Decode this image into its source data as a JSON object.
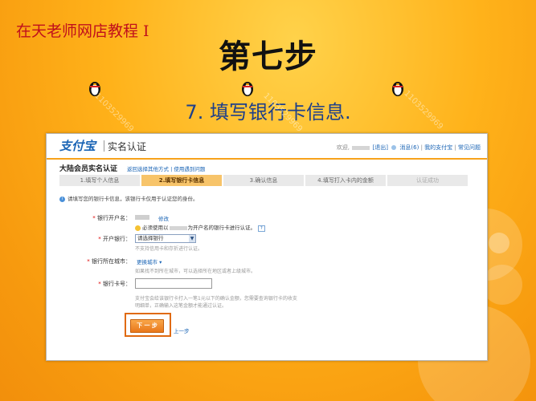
{
  "slide": {
    "header": "在天老师网店教程 I",
    "title": "第七步",
    "subtitle": "7. 填写银行卡信息."
  },
  "watermark": "1103529969",
  "screen": {
    "logo": "支付宝",
    "page_title": "实名认证",
    "topbar_right": {
      "welcome": "欢迎,",
      "logout": "[退出]",
      "messages": "消息(6)",
      "my_alipay": "我的支付宝",
      "help": "常见问题"
    },
    "section_title": "大陆会员实名认证",
    "section_links": "返回选择其他方式 | 使用遇到问题",
    "steps": [
      "1.填写个人信息",
      "2.填写银行卡信息",
      "3.确认信息",
      "4.填写打入卡内的金额",
      "认证成功"
    ],
    "notice": "请填写您的银行卡信息，该银行卡仅用于认证您的身份。",
    "form": {
      "account_name_label": "银行开户名：",
      "modify_link": "修改",
      "account_name_hint_before": "必须使用以",
      "account_name_hint_after": "为开户名的银行卡进行认证。",
      "help_mark": "?",
      "bank_label": "开户银行：",
      "bank_select": "请选择银行",
      "bank_hint": "不支持信用卡和存折进行认证。",
      "city_label": "银行所在城市：",
      "city_select": "更换城市 ▾",
      "city_hint": "如果找不到所在城市，可以选择所在地区或者上级城市。",
      "card_label": "银行卡号：",
      "card_value": "",
      "card_hint": "支付宝会给该银行卡打入一笔1元以下的确认金额，您需要查询银行卡的收支明细单，正确输入这笔金额才能通过认证。",
      "next_button": "下 一 步",
      "prev_link": "上一步"
    }
  }
}
